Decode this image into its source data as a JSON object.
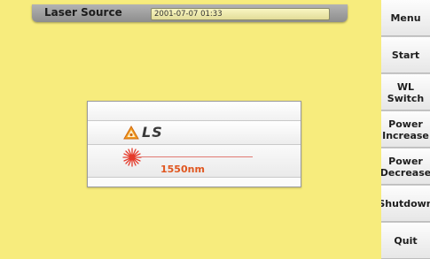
{
  "header": {
    "title": "Laser Source",
    "datetime": "2001-07-07 01:33"
  },
  "panel": {
    "source_label": "LS",
    "wavelength": "1550nm",
    "warning_icon": "laser-warning-icon",
    "laser_icon": "laser-burst-icon"
  },
  "sidebar": {
    "buttons": [
      {
        "label": "Menu"
      },
      {
        "label": "Start"
      },
      {
        "label": "WL Switch"
      },
      {
        "label": "Power\nIncrease"
      },
      {
        "label": "Power\nDecrease"
      },
      {
        "label": "Shutdown"
      },
      {
        "label": "Quit"
      }
    ]
  },
  "colors": {
    "background": "#f7ec7d",
    "accent": "#e0561f",
    "beam": "#e07a72"
  }
}
